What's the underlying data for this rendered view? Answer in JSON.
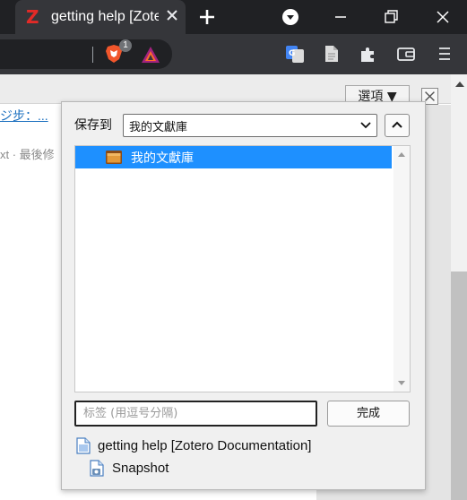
{
  "tab": {
    "title": "getting help [Zotero Documentation]",
    "favicon": "Z"
  },
  "toolbar": {
    "brave_badge_count": "1"
  },
  "page": {
    "link_text": "ジ步：...",
    "meta_text": "xt · 最後修",
    "options_label": "選項 ▼"
  },
  "popup": {
    "save_label": "保存到",
    "library_select": "我的文獻庫",
    "tree_items": [
      {
        "label": "我的文獻庫"
      }
    ],
    "tags_placeholder": "标签 (用逗号分隔)",
    "done_label": "完成",
    "items": [
      {
        "title": "getting help [Zotero Documentation]",
        "icon": "webpage-icon"
      },
      {
        "title": "Snapshot",
        "icon": "snapshot-icon"
      }
    ]
  },
  "colors": {
    "selection": "#1e90ff",
    "tab_bar": "#202124",
    "toolbar": "#35363a",
    "zotero_red": "#e22a27"
  }
}
